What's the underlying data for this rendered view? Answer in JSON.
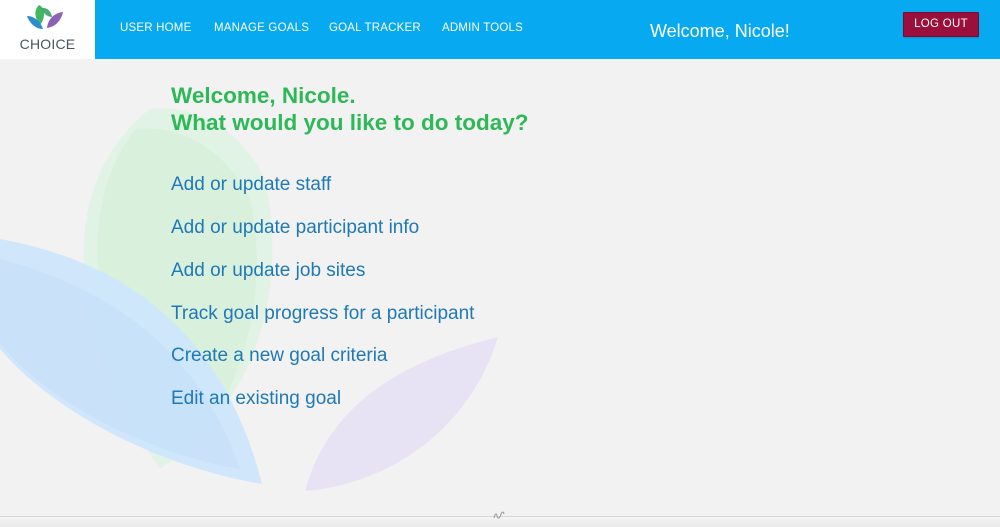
{
  "brand": {
    "logo_text": "CHOICE"
  },
  "colors": {
    "header_bg": "#07a9f1",
    "greeting": "#2fb857",
    "link": "#1f79b6",
    "logout_bg": "#9a0f3c"
  },
  "nav": {
    "items": [
      {
        "label": "USER HOME"
      },
      {
        "label": "MANAGE GOALS"
      },
      {
        "label": "GOAL TRACKER"
      },
      {
        "label": "ADMIN TOOLS"
      }
    ],
    "welcome": "Welcome, Nicole!",
    "logout_label": "LOG OUT"
  },
  "main": {
    "greeting_line1": "Welcome, Nicole.",
    "greeting_line2": "What would you like to do today?",
    "actions": [
      {
        "label": "Add or update staff"
      },
      {
        "label": "Add or update participant info"
      },
      {
        "label": "Add or update job sites"
      },
      {
        "label": "Track goal progress for a participant"
      },
      {
        "label": "Create a new goal criteria"
      },
      {
        "label": "Edit an existing goal"
      }
    ]
  },
  "icons": {
    "logo": "leaf-logo-icon",
    "footer": "resize-handle-icon"
  }
}
